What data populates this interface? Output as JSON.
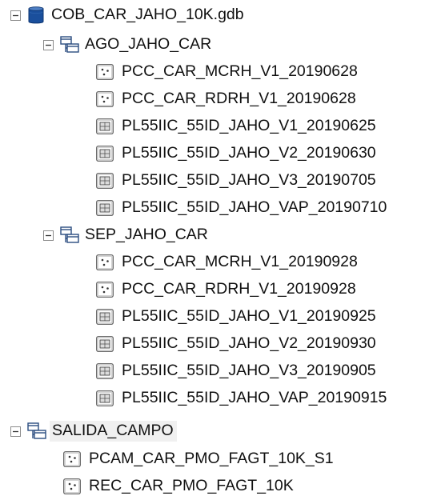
{
  "tree": {
    "root": {
      "label": "COB_CAR_JAHO_10K.gdb",
      "icon": "geodatabase-icon",
      "expanded": true
    },
    "datasets": [
      {
        "label": "AGO_JAHO_CAR",
        "icon": "feature-dataset-icon",
        "expanded": true,
        "children": [
          {
            "label": "PCC_CAR_MCRH_V1_20190628",
            "icon": "point-feature-class-icon"
          },
          {
            "label": "PCC_CAR_RDRH_V1_20190628",
            "icon": "point-feature-class-icon"
          },
          {
            "label": "PL55IIC_55ID_JAHO_V1_20190625",
            "icon": "polygon-feature-class-icon"
          },
          {
            "label": "PL55IIC_55ID_JAHO_V2_20190630",
            "icon": "polygon-feature-class-icon"
          },
          {
            "label": "PL55IIC_55ID_JAHO_V3_20190705",
            "icon": "polygon-feature-class-icon"
          },
          {
            "label": "PL55IIC_55ID_JAHO_VAP_20190710",
            "icon": "polygon-feature-class-icon"
          }
        ]
      },
      {
        "label": "SEP_JAHO_CAR",
        "icon": "feature-dataset-icon",
        "expanded": true,
        "children": [
          {
            "label": "PCC_CAR_MCRH_V1_20190928",
            "icon": "point-feature-class-icon"
          },
          {
            "label": "PCC_CAR_RDRH_V1_20190928",
            "icon": "point-feature-class-icon"
          },
          {
            "label": "PL55IIC_55ID_JAHO_V1_20190925",
            "icon": "polygon-feature-class-icon"
          },
          {
            "label": "PL55IIC_55ID_JAHO_V2_20190930",
            "icon": "polygon-feature-class-icon"
          },
          {
            "label": "PL55IIC_55ID_JAHO_V3_20190905",
            "icon": "polygon-feature-class-icon"
          },
          {
            "label": "PL55IIC_55ID_JAHO_VAP_20190915",
            "icon": "polygon-feature-class-icon"
          }
        ]
      },
      {
        "label": "SALIDA_CAMPO",
        "icon": "feature-dataset-icon",
        "expanded": true,
        "selected": true,
        "children": [
          {
            "label": "PCAM_CAR_PMO_FAGT_10K_S1",
            "icon": "point-feature-class-icon"
          },
          {
            "label": "REC_CAR_PMO_FAGT_10K",
            "icon": "point-feature-class-icon"
          }
        ]
      }
    ]
  },
  "colors": {
    "database_fill": "#1a4f9c",
    "dataset_line": "#2b4d80",
    "feature_border": "#555555",
    "selection_bg": "#f0f0f0"
  }
}
